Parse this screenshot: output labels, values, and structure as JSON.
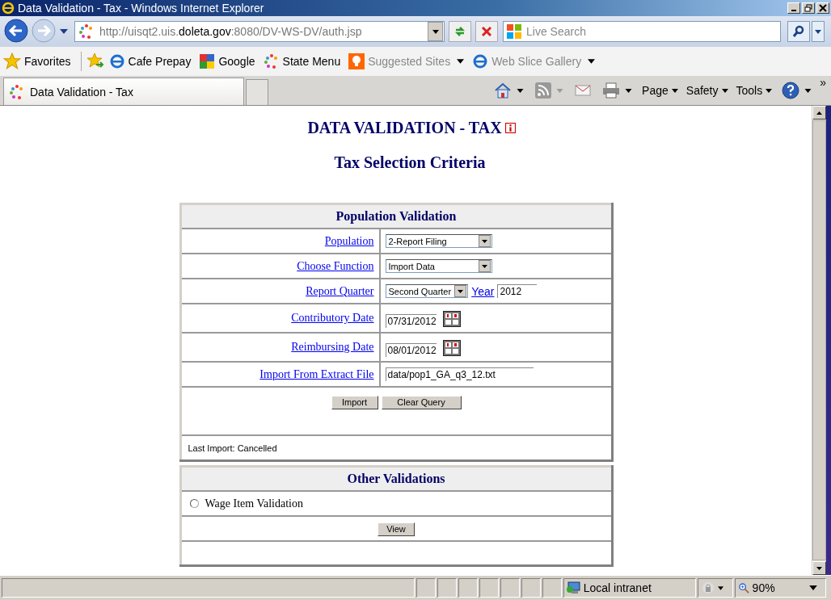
{
  "window": {
    "title": "Data Validation - Tax - Windows Internet Explorer"
  },
  "address_bar": {
    "url_start": "http://uisqt2.uis.",
    "url_domain": "doleta.gov",
    "url_end": ":8080/DV-WS-DV/auth.jsp"
  },
  "search": {
    "placeholder": "Live Search"
  },
  "favorites_bar": {
    "label": "Favorites",
    "links": [
      {
        "label": "Cafe Prepay",
        "kind": "ie",
        "dropdown": false,
        "disabled": false
      },
      {
        "label": "Google",
        "kind": "google",
        "dropdown": false,
        "disabled": false
      },
      {
        "label": "State Menu",
        "kind": "dots",
        "dropdown": false,
        "disabled": false
      },
      {
        "label": "Suggested Sites",
        "kind": "bulb",
        "dropdown": true,
        "disabled": true
      },
      {
        "label": "Web Slice Gallery",
        "kind": "ie",
        "dropdown": true,
        "disabled": true
      }
    ]
  },
  "tabs": [
    {
      "label": "Data Validation - Tax",
      "selected": true
    }
  ],
  "command_bar": {
    "menus": [
      "Page",
      "Safety",
      "Tools"
    ],
    "overflow": "»"
  },
  "page": {
    "title": "DATA VALIDATION - TAX",
    "subtitle": "Tax Selection Criteria",
    "population_panel": {
      "title": "Population Validation",
      "rows": [
        {
          "label": "Population",
          "controls": [
            {
              "kind": "select",
              "value": "2-Report Filing"
            }
          ]
        },
        {
          "label": "Choose Function",
          "controls": [
            {
              "kind": "select",
              "value": "Import Data"
            }
          ]
        },
        {
          "label": "Report Quarter",
          "controls": [
            {
              "kind": "select",
              "value": "Second Quarter"
            },
            {
              "kind": "link",
              "value": "Year"
            },
            {
              "kind": "text",
              "value": "2012"
            }
          ]
        },
        {
          "label": "Contributory Date",
          "controls": [
            {
              "kind": "date",
              "value": "07/31/2012"
            }
          ]
        },
        {
          "label": "Reimbursing Date",
          "controls": [
            {
              "kind": "date",
              "value": "08/01/2012"
            }
          ]
        },
        {
          "label": "Import From Extract File",
          "controls": [
            {
              "kind": "file",
              "value": "data/pop1_GA_q3_12.txt"
            }
          ]
        }
      ],
      "buttons": [
        "Import",
        "Clear Query"
      ],
      "status": "Last Import: Cancelled"
    },
    "other_panel": {
      "title": "Other Validations",
      "options": [
        {
          "label": "Wage Item Validation",
          "selected": false
        }
      ],
      "buttons": [
        "View"
      ]
    }
  },
  "status_bar": {
    "zone": "Local intranet",
    "zoom": "90%"
  }
}
